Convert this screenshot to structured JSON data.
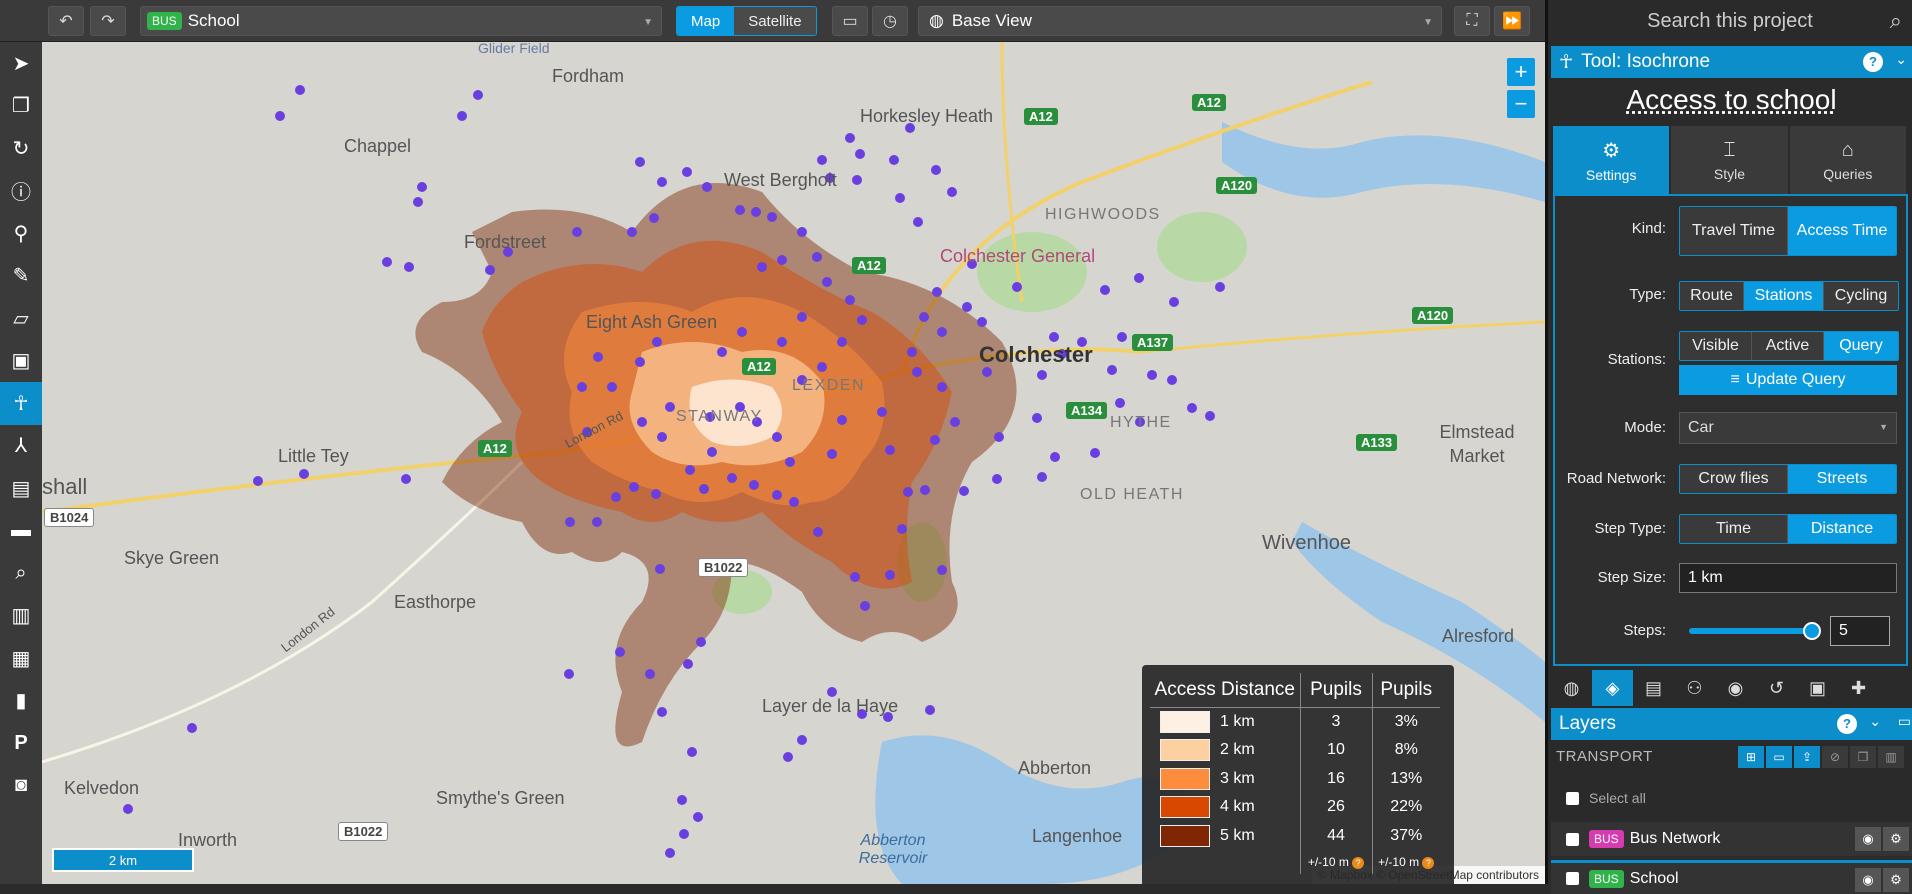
{
  "topbar": {
    "undo_icon": "undo-icon",
    "redo_icon": "redo-icon",
    "project_badge": "BUS",
    "project_name": "School",
    "map_tabs": [
      {
        "label": "Map",
        "active": true
      },
      {
        "label": "Satellite",
        "active": false
      }
    ],
    "base_view": "Base View"
  },
  "toolbar": [
    "pointer-icon",
    "layers-copy-icon",
    "refresh-icon",
    "info-icon",
    "pin-icon",
    "pencil-icon",
    "eraser-icon",
    "train-icon",
    "isochrone-icon",
    "merge-icon",
    "comment-icon",
    "ruler-icon",
    "search-icon",
    "book-icon",
    "chip-icon",
    "chart-icon",
    "parking-icon",
    "camera-icon"
  ],
  "map": {
    "places": [
      "Fordham",
      "Chappel",
      "Horkesley Heath",
      "West Bergholt",
      "Fordstreet",
      "HIGHWOODS",
      "Colchester General",
      "Eight Ash Green",
      "Colchester",
      "LEXDEN",
      "STANWAY",
      "HYTHE",
      "Elmstead Market",
      "Little Tey",
      "OLD HEATH",
      "Wivenhoe",
      "Skye Green",
      "Easthorpe",
      "Layer de la Haye",
      "Alresford",
      "Kelvedon",
      "Smythe's Green",
      "Abberton",
      "Inworth",
      "Langenhoe",
      "Abberton Reservoir",
      "Glider Field",
      "London Rd",
      "London Rd",
      "shall"
    ],
    "roads": [
      "A12",
      "A12",
      "A12",
      "A12",
      "A12",
      "A120",
      "A120",
      "A137",
      "A134",
      "A133",
      "B1024",
      "B1022",
      "B1022"
    ],
    "scale": "2 km",
    "attribution": "© Mapbox © OpenStreetMap contributors",
    "zoom_in": "+",
    "zoom_out": "−"
  },
  "legend": {
    "headers": [
      "Access Distance",
      "Pupils",
      "Pupils"
    ],
    "rows": [
      {
        "label": "1 km",
        "count": "3",
        "pct": "3%",
        "color": "#fff0e4"
      },
      {
        "label": "2 km",
        "count": "10",
        "pct": "8%",
        "color": "#fdd0a2"
      },
      {
        "label": "3 km",
        "count": "16",
        "pct": "13%",
        "color": "#fd8d3c"
      },
      {
        "label": "4 km",
        "count": "26",
        "pct": "22%",
        "color": "#d94801"
      },
      {
        "label": "5 km",
        "count": "44",
        "pct": "37%",
        "color": "#7f2704"
      }
    ],
    "footnote1": "+/-10 m",
    "footnote2": "+/-10 m"
  },
  "panel": {
    "search_placeholder": "Search this project",
    "tool_header": "Tool: Isochrone",
    "title": "Access to school",
    "tabs": [
      {
        "label": "Settings",
        "active": true
      },
      {
        "label": "Style",
        "active": false
      },
      {
        "label": "Queries",
        "active": false
      }
    ],
    "kind": {
      "label": "Kind:",
      "options": [
        "Travel Time",
        "Access Time"
      ],
      "active": 1
    },
    "type": {
      "label": "Type:",
      "options": [
        "Route",
        "Stations",
        "Cycling"
      ],
      "active": 1
    },
    "stations": {
      "label": "Stations:",
      "options": [
        "Visible",
        "Active",
        "Query"
      ],
      "active": 2
    },
    "update_query": "Update Query",
    "mode": {
      "label": "Mode:",
      "value": "Car"
    },
    "road_network": {
      "label": "Road Network:",
      "options": [
        "Crow flies",
        "Streets"
      ],
      "active": 1
    },
    "step_type": {
      "label": "Step Type:",
      "options": [
        "Time",
        "Distance"
      ],
      "active": 1
    },
    "step_size": {
      "label": "Step Size:",
      "value": "1 km"
    },
    "steps": {
      "label": "Steps:",
      "value": "5",
      "level": 1.0
    },
    "layers_title": "Layers",
    "transport_label": "TRANSPORT",
    "select_all": "Select all",
    "layers": [
      {
        "badge": "BUS",
        "name": "Bus Network",
        "badge_color": "#d63bb0"
      },
      {
        "badge": "BUS",
        "name": "School",
        "badge_color": "#2fb34a"
      }
    ]
  }
}
